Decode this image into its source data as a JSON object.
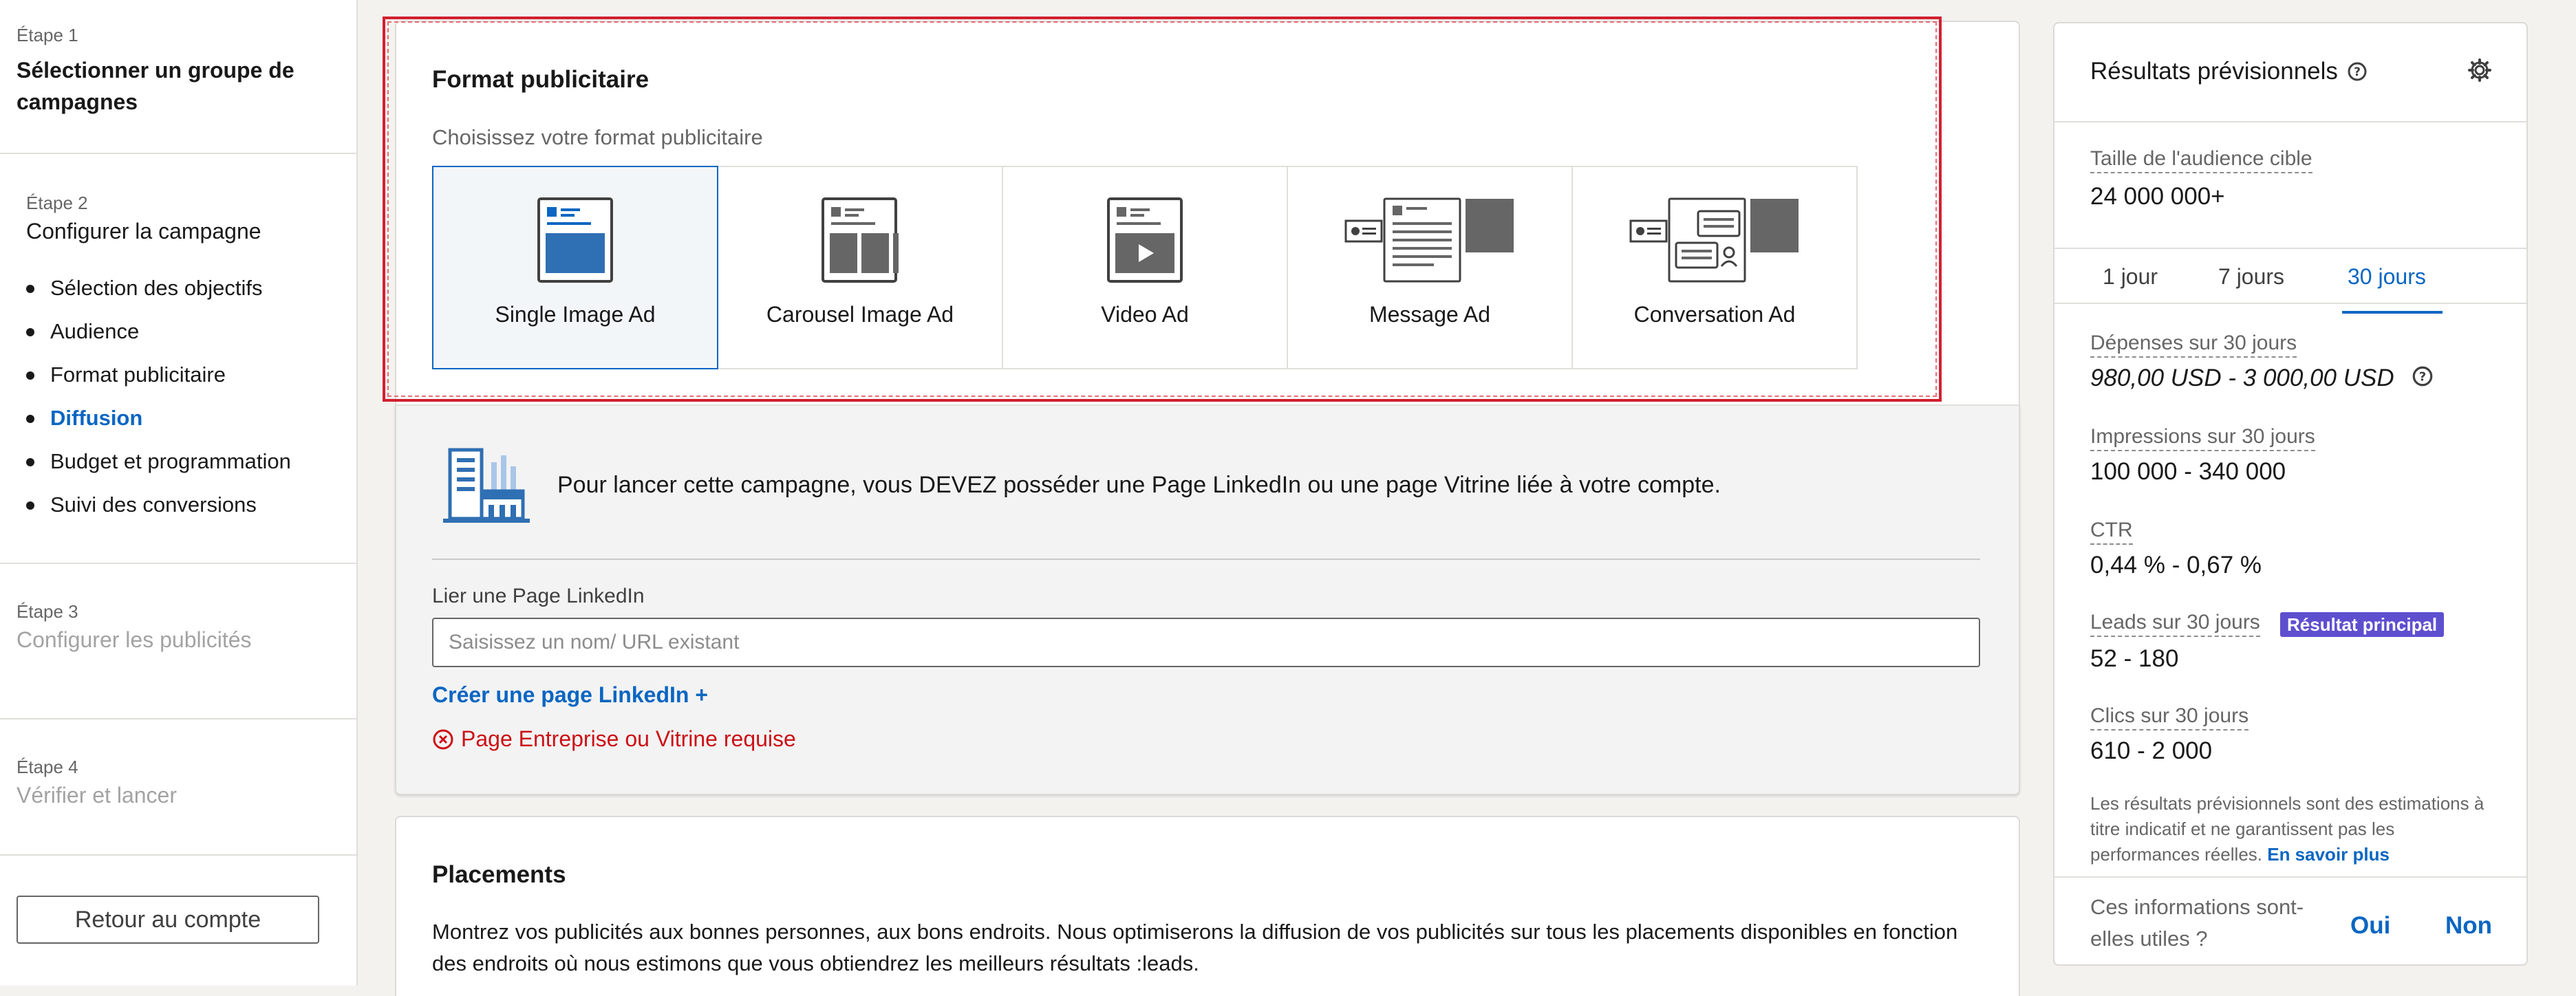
{
  "sidebar": {
    "step1": {
      "label": "Étape 1",
      "title": "Sélectionner un groupe de campagnes"
    },
    "step2": {
      "label": "Étape 2",
      "title": "Configurer la campagne",
      "items": [
        {
          "label": "Sélection des objectifs",
          "active": false
        },
        {
          "label": "Audience",
          "active": false
        },
        {
          "label": "Format publicitaire",
          "active": false
        },
        {
          "label": "Diffusion",
          "active": true
        },
        {
          "label": "Budget et programmation",
          "active": false
        },
        {
          "label": "Suivi des conversions",
          "active": false
        }
      ]
    },
    "step3": {
      "label": "Étape 3",
      "title": "Configurer les publicités"
    },
    "step4": {
      "label": "Étape 4",
      "title": "Vérifier et lancer"
    },
    "back_button": "Retour au compte"
  },
  "ad_format": {
    "title": "Format publicitaire",
    "hint": "Choisissez votre format publicitaire",
    "options": [
      {
        "label": "Single Image Ad",
        "icon": "single-image-ad-icon",
        "selected": true
      },
      {
        "label": "Carousel Image Ad",
        "icon": "carousel-image-ad-icon",
        "selected": false
      },
      {
        "label": "Video Ad",
        "icon": "video-ad-icon",
        "selected": false
      },
      {
        "label": "Message Ad",
        "icon": "message-ad-icon",
        "selected": false
      },
      {
        "label": "Conversation Ad",
        "icon": "conversation-ad-icon",
        "selected": false
      }
    ]
  },
  "linkedin_page": {
    "message": "Pour lancer cette campagne, vous DEVEZ posséder une Page LinkedIn ou une page Vitrine liée à votre compte.",
    "field_label": "Lier une Page LinkedIn",
    "input_placeholder": "Saisissez un nom/ URL existant",
    "input_value": "",
    "create_link": "Créer une page LinkedIn +",
    "error": "Page Entreprise ou Vitrine requise"
  },
  "placements": {
    "title": "Placements",
    "body": "Montrez vos publicités aux bonnes personnes, aux bons endroits. Nous optimiserons la diffusion de vos publicités sur tous les placements disponibles en fonction des endroits où nous estimons que vous obtiendrez les meilleurs résultats :leads."
  },
  "forecast": {
    "title": "Résultats prévisionnels",
    "audience_label": "Taille de l'audience cible",
    "audience_value": "24 000 000+",
    "tabs": [
      "1 jour",
      "7 jours",
      "30 jours"
    ],
    "active_tab": "30 jours",
    "spend_label": "Dépenses sur 30 jours",
    "spend_value": "980,00 USD - 3 000,00 USD",
    "impressions_label": "Impressions sur 30 jours",
    "impressions_value": "100 000 - 340 000",
    "ctr_label": "CTR",
    "ctr_value": "0,44 % - 0,67 %",
    "leads_label": "Leads sur 30 jours",
    "leads_badge": "Résultat principal",
    "leads_value": "52 - 180",
    "clicks_label": "Clics sur 30 jours",
    "clicks_value": "610 - 2 000",
    "disclaimer": "Les résultats prévisionnels sont des estimations à titre indicatif et ne garantissent pas les performances réelles.",
    "learn_more": "En savoir plus",
    "feedback_question": "Ces informations sont-elles utiles ?",
    "yes": "Oui",
    "no": "Non"
  },
  "colors": {
    "accent": "#0a66c2",
    "error": "#cc1016",
    "badge": "#5e4fcf",
    "highlight_border": "#d1202f"
  }
}
